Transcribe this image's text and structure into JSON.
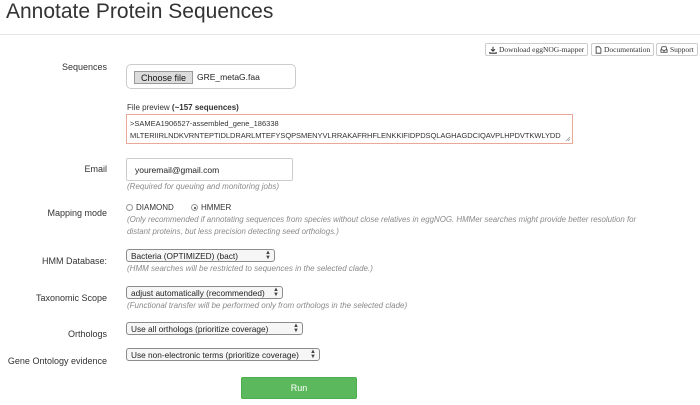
{
  "page": {
    "title": "Annotate Protein Sequences"
  },
  "top_buttons": {
    "download": "Download eggNOG-mapper",
    "documentation": "Documentation",
    "support": "Support"
  },
  "sequences": {
    "label": "Sequences",
    "choose_file": "Choose file",
    "file_name": "GRE_metaG.faa",
    "preview_label": "File preview",
    "preview_count": "(~157 sequences)",
    "preview_line1": ">SAMEA1906527-assembled_gene_186338",
    "preview_line2": "MLTERIIRLNDKVRNTEPTIDLDRARLMTEFYSQPSMENYVLRRAKAFRHFLENKKIFIDPDSQLAGHAGDCIQAVPLHPDVTKWLYDD"
  },
  "email": {
    "label": "Email",
    "value": "youremail@gmail.com",
    "help": "(Required for queuing and monitoring jobs)"
  },
  "mapping_mode": {
    "label": "Mapping mode",
    "options": [
      "DIAMOND",
      "HMMER"
    ],
    "selected": "HMMER",
    "help_line1": "(Only recommended if annotating sequences from species without close relatives in eggNOG. HMMer searches might provide better resolution for",
    "help_line2": "distant proteins, but less precision detecting seed orthologs.)"
  },
  "hmm_database": {
    "label": "HMM Database:",
    "value": "Bacteria (OPTIMIZED) (bact)",
    "help": "(HMM searches will be restricted to sequences in the selected clade.)"
  },
  "taxonomic_scope": {
    "label": "Taxonomic Scope",
    "value": "adjust automatically (recommended)",
    "help": "(Functional transfer will be performed only from orthologs in the selected clade)"
  },
  "orthologs": {
    "label": "Orthologs",
    "value": "Use all orthologs (prioritize coverage)"
  },
  "go_evidence": {
    "label": "Gene Ontology evidence",
    "value": "Use non-electronic terms (prioritize coverage)"
  },
  "run_button": {
    "label": "Run"
  },
  "colors": {
    "run_green": "#5cb85c",
    "preview_border": "#e8a89a"
  }
}
